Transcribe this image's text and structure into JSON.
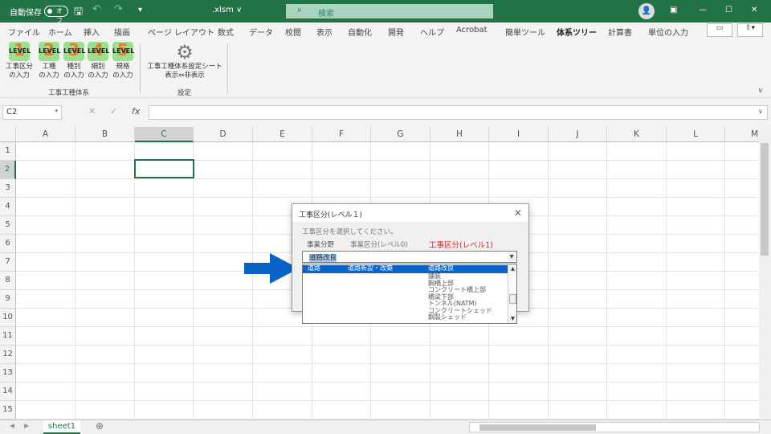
{
  "titlebar": {
    "autosave": "自動保存",
    "toggle": "オフ",
    "filename": ".xlsm ∨",
    "search": "検索"
  },
  "menu": [
    "ファイル",
    "ホーム",
    "挿入",
    "描画",
    "ページ レイアウト",
    "数式",
    "データ",
    "校閲",
    "表示",
    "自動化",
    "開発",
    "ヘルプ",
    "Acrobat",
    "簡単ツール",
    "体系ツリー",
    "計算書",
    "単位の入力"
  ],
  "active_tab": "体系ツリー",
  "ribbon": {
    "buttons": [
      {
        "num": "1",
        "line1": "工事区分",
        "line2": "の入力"
      },
      {
        "num": "2",
        "line1": "工種",
        "line2": "の入力"
      },
      {
        "num": "3",
        "line1": "種別",
        "line2": "の入力"
      },
      {
        "num": "4",
        "line1": "細別",
        "line2": "の入力"
      },
      {
        "num": "5",
        "line1": "規格",
        "line2": "の入力"
      }
    ],
    "level_text": "LEVEL",
    "group1": "工事工種体系",
    "settings_line1": "工事工種体系設定シート",
    "settings_line2": "表示⇔非表示",
    "group2": "設定"
  },
  "formula": {
    "namebox": "C2",
    "fx": "fx",
    "value": ""
  },
  "columns": [
    "A",
    "B",
    "C",
    "D",
    "E",
    "F",
    "G",
    "H",
    "I",
    "J",
    "K",
    "L",
    "M"
  ],
  "rows": [
    "1",
    "2",
    "3",
    "4",
    "5",
    "6",
    "7",
    "8",
    "9",
    "10",
    "11",
    "12",
    "13",
    "14",
    "15"
  ],
  "selected_cell": "C2",
  "sheets": [
    "sheet1"
  ],
  "dialog": {
    "title": "工事区分(レベル１)",
    "close": "✕",
    "prompt": "工事区分を選択してください。",
    "headers": [
      "事業分野",
      "事業区分(レベル0)",
      "工事区分(レベル1)"
    ],
    "combo_value": "道路改良",
    "list": [
      {
        "c1": "道路",
        "c2": "道路新設・改築",
        "c3": "道路改良",
        "selected": true
      },
      {
        "c3": "舗装"
      },
      {
        "c3": "鋼橋上部"
      },
      {
        "c3": "コンクリート橋上部"
      },
      {
        "c3": "橋梁下部"
      },
      {
        "c3": "トンネル(NATM)"
      },
      {
        "c3": "コンクリートシェッド"
      },
      {
        "c3": "鋼製シェッド"
      }
    ]
  },
  "colors": {
    "excel_green": "#217346",
    "highlight_blue": "#0a64c8",
    "header_red": "#e02020",
    "arrow_blue": "#0a64c8"
  }
}
